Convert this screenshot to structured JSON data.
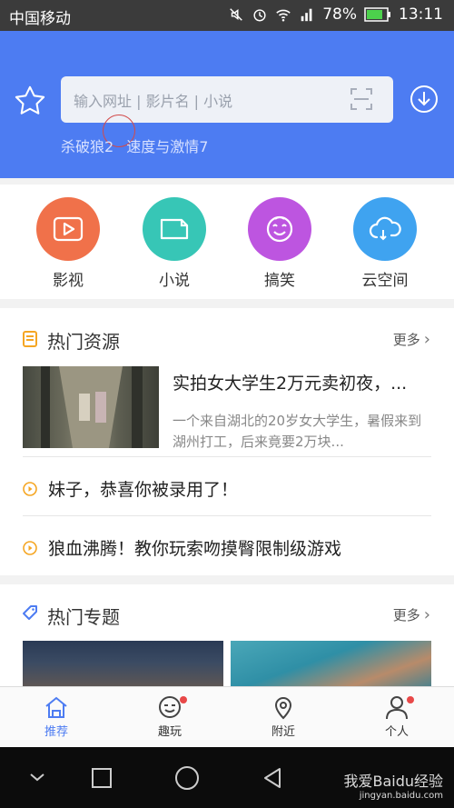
{
  "status_bar": {
    "carrier": "中国移动",
    "battery": "78%",
    "time": "13:11"
  },
  "header": {
    "search_placeholder": "输入网址 | 影片名 | 小说",
    "hot_words": [
      "杀破狼2",
      "速度与激情7"
    ]
  },
  "quick_access": [
    {
      "label": "影视",
      "color": "#f0714a",
      "icon": "play-icon"
    },
    {
      "label": "小说",
      "color": "#37c6b6",
      "icon": "book-icon"
    },
    {
      "label": "搞笑",
      "color": "#bd55e0",
      "icon": "smiley-icon"
    },
    {
      "label": "云空间",
      "color": "#3fa3f0",
      "icon": "cloud-icon"
    }
  ],
  "hot_resources": {
    "title": "热门资源",
    "more": "更多",
    "featured": {
      "title": "实拍女大学生2万元卖初夜，...",
      "description": "一个来自湖北的20岁女大学生，暑假来到湖州打工，后来竟要2万块..."
    },
    "news": [
      "妹子，恭喜你被录用了！",
      "狼血沸腾！教你玩索吻摸臀限制级游戏"
    ]
  },
  "hot_topics": {
    "title": "热门专题",
    "more": "更多"
  },
  "tab_bar": [
    {
      "label": "推荐",
      "active": true,
      "badge": false
    },
    {
      "label": "趣玩",
      "active": false,
      "badge": true
    },
    {
      "label": "附近",
      "active": false,
      "badge": false
    },
    {
      "label": "个人",
      "active": false,
      "badge": true
    }
  ],
  "watermark": {
    "main": "我爱Baidu经验",
    "sub": "jingyan.baidu.com"
  },
  "colors": {
    "header_blue": "#4d7cf2",
    "accent_orange": "#f5a623",
    "badge_red": "#e84848",
    "tab_active": "#4d7cf2"
  }
}
